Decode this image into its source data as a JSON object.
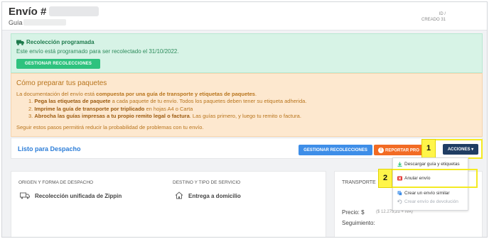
{
  "header": {
    "title": "Envío #",
    "guia_label": "Guía",
    "meta_id": "ID /",
    "meta_created": "CREADO 31"
  },
  "alert_scheduled": {
    "icon": "truck-icon",
    "title": "Recolección programada",
    "text": "Este envío está programado para ser recolectado el 31/10/2022.",
    "button": "GESTIONAR RECOLECCIONES"
  },
  "instructions": {
    "title": "Cómo preparar tus paquetes",
    "intro_prefix": "La documentación del envío está ",
    "intro_bold": "compuesta por una guía de transporte y etiquetas de paquetes",
    "intro_suffix": ".",
    "steps": [
      {
        "num": "1.",
        "bold": "Pega las etiquetas de paquete",
        "text": " a cada paquete de tu envío. Todos los paquetes deben tener su etiqueta adherida."
      },
      {
        "num": "2.",
        "bold": "Imprime la guía de transporte por triplicado",
        "text": " en hojas A4 o Carta"
      },
      {
        "num": "3.",
        "bold": "Abrocha las guías impresas a tu propio remito legal o factura",
        "text": ". Las guías primero, y luego tu remito o factura."
      }
    ],
    "footer": "Seguir estos pasos permitirá reducir la probabilidad de problemas con tu envío."
  },
  "status_bar": {
    "status_link": "Listo para Despacho",
    "btn_manage": "GESTIONAR RECOLECCIONES",
    "btn_report": "REPORTAR PRO",
    "btn_actions": "ACCIONES ▾",
    "badge_1": "1"
  },
  "dropdown": {
    "items": [
      {
        "icon": "download-icon",
        "label": "Descargar guía y etiquetas"
      },
      {
        "icon": "cancel-icon",
        "label": "Anular envío"
      },
      {
        "icon": "copy-icon",
        "label": "Crear un envío similar"
      },
      {
        "icon": "return-icon",
        "label": "Crear envío de devolución"
      }
    ],
    "badge_2": "2"
  },
  "shipping_info": {
    "origin_head": "ORIGEN Y FORMA DE DESPACHO",
    "origin_value": "Recolección unificada de Zippin",
    "dest_head": "DESTINO Y TIPO DE SERVICIO",
    "dest_value": "Entrega a domicilio"
  },
  "transport": {
    "head": "TRANSPORTE",
    "price_label": "Precio: $",
    "price_value": "($ 12.275,21 + IVA)",
    "tracking_label": "Seguimiento:"
  },
  "colors": {
    "green_bg": "#d7f3e6",
    "green_button": "#2ec27e",
    "orange_bg": "#fde8cf",
    "blue_button": "#3e8ee8",
    "orange_button": "#f26b24",
    "navy_button": "#1f3d63",
    "highlight_yellow": "#fff54a"
  }
}
